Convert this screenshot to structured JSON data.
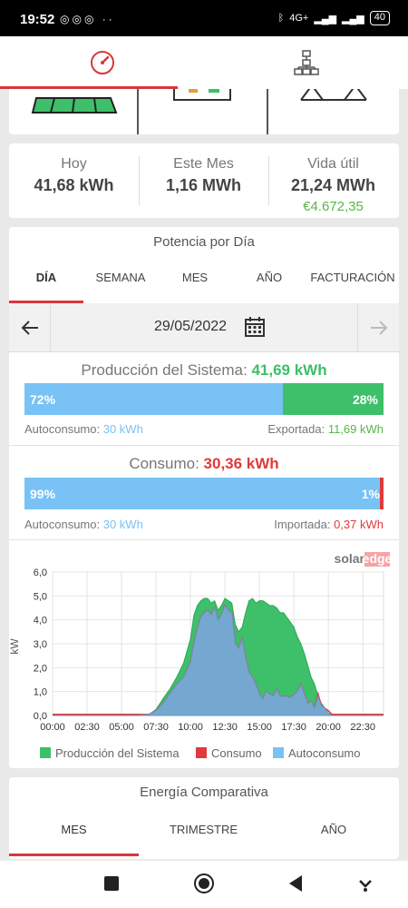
{
  "status_bar": {
    "time": "19:52",
    "network": "4G+",
    "battery": "40"
  },
  "energy": {
    "today_label": "Hoy",
    "today_value": "41,68 kWh",
    "month_label": "Este Mes",
    "month_value": "1,16 MWh",
    "lifetime_label": "Vida útil",
    "lifetime_value": "21,24 MWh",
    "lifetime_money": "€4.672,35"
  },
  "power": {
    "title": "Potencia por Día",
    "tabs": [
      "DÍA",
      "SEMANA",
      "MES",
      "AÑO",
      "FACTURACIÓN"
    ],
    "active_tab": "DÍA",
    "date": "29/05/2022"
  },
  "production": {
    "label": "Producción del Sistema:",
    "value": "41,69 kWh",
    "self_pct": "72%",
    "export_pct": "28%",
    "self_label": "Autoconsumo:",
    "self_value": "30 kWh",
    "export_label": "Exportada:",
    "export_value": "11,69 kWh",
    "self_fraction": 0.72
  },
  "consumption": {
    "label": "Consumo:",
    "value": "30,36 kWh",
    "self_pct": "99%",
    "import_pct": "1%",
    "self_label": "Autoconsumo:",
    "self_value": "30 kWh",
    "import_label": "Importada:",
    "import_value": "0,37 kWh",
    "self_fraction": 0.99
  },
  "colors": {
    "accent": "#d9373b",
    "production": "#3ebf6a",
    "self": "#78c2f5",
    "consumption": "#e03a3a",
    "money": "#59b54a"
  },
  "brand": "solaredge",
  "chart_data": {
    "type": "area",
    "ylabel": "kW",
    "ylim": [
      0,
      6
    ],
    "yticks": [
      "0,0",
      "1,0",
      "2,0",
      "3,0",
      "4,0",
      "5,0",
      "6,0"
    ],
    "xticks": [
      "00:00",
      "02:30",
      "05:00",
      "07:30",
      "10:00",
      "12:30",
      "15:00",
      "17:30",
      "20:00",
      "22:30"
    ],
    "x_hours": [
      0,
      3,
      5,
      6,
      7,
      7.5,
      8,
      8.5,
      9,
      9.5,
      10,
      10.25,
      10.5,
      10.75,
      11,
      11.25,
      11.5,
      11.75,
      12,
      12.25,
      12.5,
      12.75,
      13,
      13.25,
      13.5,
      13.75,
      14,
      14.25,
      14.5,
      14.75,
      15,
      15.25,
      15.5,
      15.75,
      16,
      16.25,
      16.5,
      16.75,
      17,
      17.25,
      17.5,
      17.75,
      18,
      18.25,
      18.5,
      18.75,
      19,
      19.25,
      19.5,
      19.75,
      20,
      20.25,
      21,
      24
    ],
    "series": [
      {
        "name": "Producción del Sistema",
        "values": [
          0,
          0,
          0,
          0,
          0.05,
          0.25,
          0.7,
          1.1,
          1.6,
          2.2,
          3.2,
          4.2,
          4.6,
          4.8,
          4.9,
          4.9,
          4.7,
          4.8,
          4.4,
          4.6,
          4.9,
          4.8,
          4.7,
          3.8,
          3.5,
          3.7,
          4.3,
          4.8,
          4.9,
          4.7,
          4.8,
          4.8,
          4.7,
          4.6,
          4.6,
          4.5,
          4.3,
          4.3,
          4.1,
          3.9,
          3.7,
          3.3,
          3.0,
          2.6,
          2.1,
          1.6,
          1.3,
          0.8,
          0.5,
          0.3,
          0.1,
          0,
          0,
          0
        ]
      },
      {
        "name": "Consumo",
        "values": [
          0.05,
          0.05,
          0.05,
          0.05,
          0.05,
          0.2,
          0.5,
          0.9,
          1.3,
          1.6,
          2.2,
          3.0,
          3.6,
          4.1,
          4.3,
          4.4,
          4.2,
          4.5,
          4.0,
          4.2,
          4.6,
          4.4,
          4.3,
          3.0,
          2.8,
          3.2,
          2.4,
          1.8,
          1.6,
          1.3,
          0.9,
          0.7,
          1.0,
          0.9,
          0.8,
          1.1,
          0.8,
          0.8,
          0.8,
          0.75,
          0.85,
          1.0,
          1.3,
          0.9,
          0.5,
          0.6,
          0.3,
          0.9,
          0.4,
          0.3,
          0.2,
          0.05,
          0.05,
          0.05
        ]
      },
      {
        "name": "Autoconsumo",
        "values": [
          0,
          0,
          0,
          0,
          0.05,
          0.2,
          0.5,
          0.9,
          1.3,
          1.6,
          2.2,
          3.0,
          3.6,
          4.1,
          4.3,
          4.4,
          4.2,
          4.5,
          4.0,
          4.2,
          4.6,
          4.4,
          4.3,
          3.0,
          2.8,
          3.2,
          2.4,
          1.8,
          1.6,
          1.3,
          0.9,
          0.7,
          1.0,
          0.9,
          0.8,
          1.1,
          0.8,
          0.8,
          0.8,
          0.75,
          0.85,
          1.0,
          1.3,
          0.9,
          0.5,
          0.6,
          0.3,
          0.8,
          0.4,
          0.3,
          0.1,
          0,
          0,
          0
        ]
      }
    ],
    "legend": "bottom"
  },
  "comparative": {
    "title": "Energía Comparativa",
    "tabs": [
      "MES",
      "TRIMESTRE",
      "AÑO"
    ],
    "active_tab": "MES"
  },
  "icons": {
    "dashboard": "gauge-icon",
    "layout": "hierarchy-icon",
    "calendar": "calendar-icon"
  }
}
